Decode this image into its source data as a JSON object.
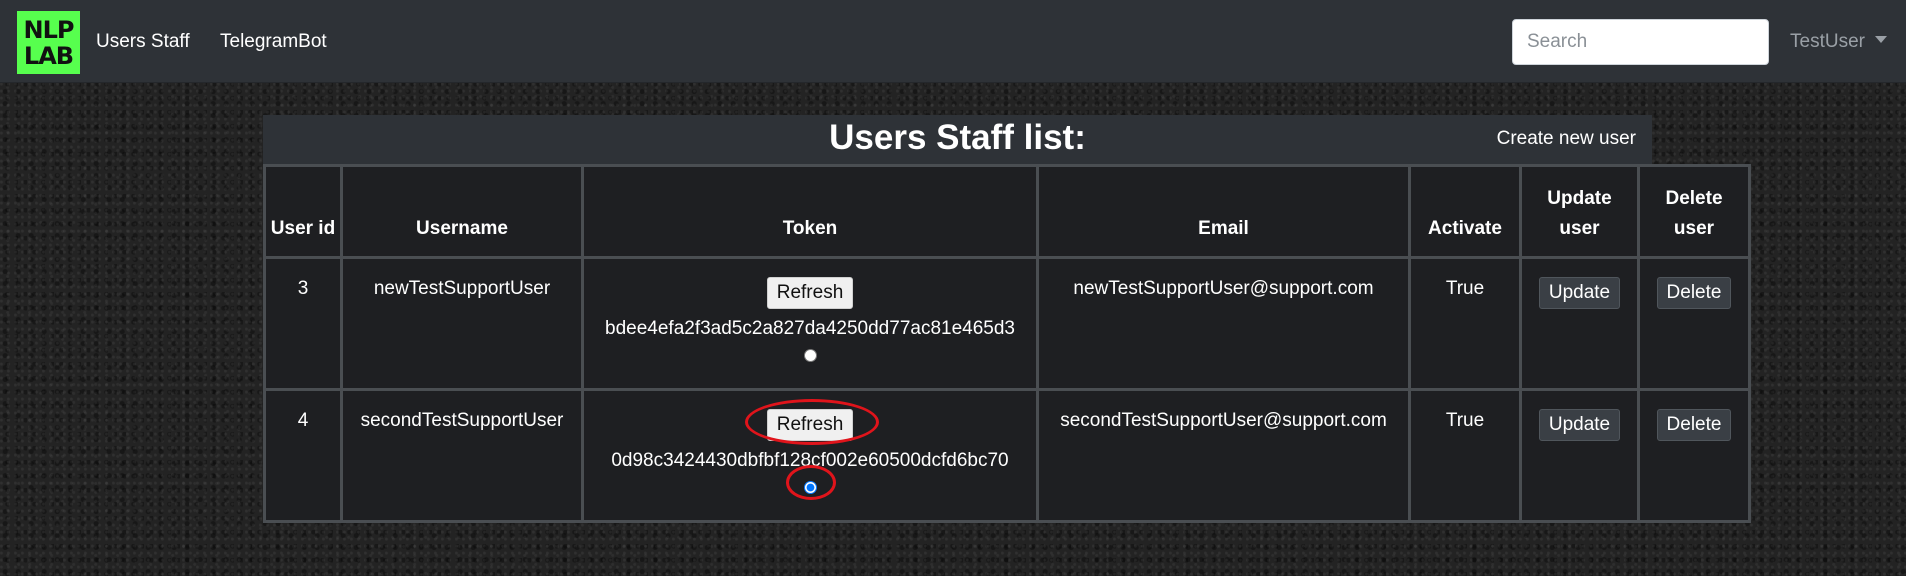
{
  "navbar": {
    "logo_lines": [
      "NLP",
      "LAB"
    ],
    "links": [
      "Users Staff",
      "TelegramBot"
    ],
    "search_placeholder": "Search",
    "user": "TestUser"
  },
  "panel": {
    "title": "Users Staff list:",
    "create_link": "Create new user"
  },
  "table": {
    "headers": {
      "user_id": "User id",
      "username": "Username",
      "token": "Token",
      "email": "Email",
      "activate": "Activate",
      "update_user": "Update user",
      "delete_user": "Delete user"
    },
    "rows": [
      {
        "id": "3",
        "username": "newTestSupportUser",
        "refresh_label": "Refresh",
        "token": "bdee4efa2f3ad5c2a827da4250dd77ac81e465d3",
        "radio_checked": false,
        "email": "newTestSupportUser@support.com",
        "activate": "True",
        "update_label": "Update",
        "delete_label": "Delete"
      },
      {
        "id": "4",
        "username": "secondTestSupportUser",
        "refresh_label": "Refresh",
        "token": "0d98c3424430dbfbf128cf002e60500dcfd6bc70",
        "radio_checked": true,
        "email": "secondTestSupportUser@support.com",
        "activate": "True",
        "update_label": "Update",
        "delete_label": "Delete"
      }
    ]
  },
  "colors": {
    "logo_bg": "#57ff4e",
    "navbar_bg": "#2e3237",
    "annotation_red": "#e0141b"
  }
}
